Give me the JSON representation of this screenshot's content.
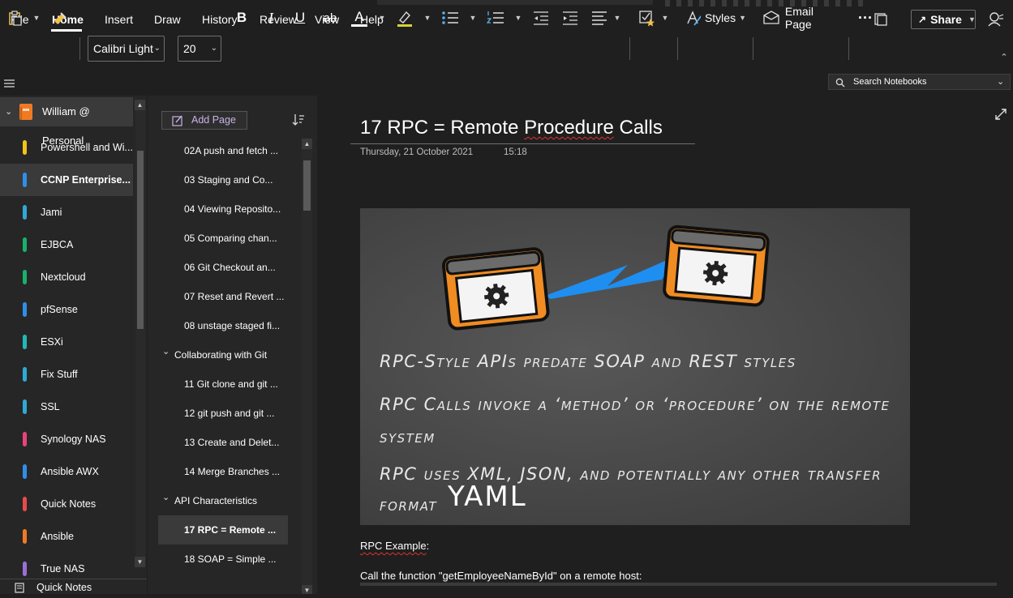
{
  "menu": {
    "items": [
      "File",
      "Home",
      "Insert",
      "Draw",
      "History",
      "Review",
      "View",
      "Help"
    ],
    "active": "Home"
  },
  "header_actions": {
    "share_label": "Share"
  },
  "ribbon": {
    "font_name": "Calibri Light",
    "font_size": "20",
    "bold": "B",
    "italic": "I",
    "underline": "U",
    "strike": "ab",
    "font_color": "A",
    "styles_label": "Styles",
    "email_label": "Email Page",
    "more_label": "···"
  },
  "search": {
    "placeholder": "Search Notebooks"
  },
  "notebook": {
    "name": "William @ Personal",
    "sections": [
      {
        "label": "Powershell and Wi...",
        "color": "#f2c318"
      },
      {
        "label": "CCNP Enterprise...",
        "color": "#2f8fe8"
      },
      {
        "label": "Jami",
        "color": "#2fa9d6"
      },
      {
        "label": "EJBCA",
        "color": "#18b06a"
      },
      {
        "label": "Nextcloud",
        "color": "#18b06a"
      },
      {
        "label": "pfSense",
        "color": "#2f8fe8"
      },
      {
        "label": "ESXi",
        "color": "#22b8b8"
      },
      {
        "label": "Fix Stuff",
        "color": "#2fa9d6"
      },
      {
        "label": "SSL",
        "color": "#2fa9d6"
      },
      {
        "label": "Synology NAS",
        "color": "#e8447a"
      },
      {
        "label": "Ansible AWX",
        "color": "#2f8fe8"
      },
      {
        "label": "Quick Notes",
        "color": "#e84b4b"
      },
      {
        "label": "Ansible",
        "color": "#f07a23"
      },
      {
        "label": "True NAS",
        "color": "#9b6fd8"
      }
    ],
    "selected_index": 1,
    "bottom_label": "Quick Notes"
  },
  "pages": {
    "add_label": "Add Page",
    "items": [
      {
        "label": "02A push and fetch ...",
        "level": 2
      },
      {
        "label": "03 Staging and Co...",
        "level": 2
      },
      {
        "label": "04 Viewing Reposito...",
        "level": 2
      },
      {
        "label": "05 Comparing chan...",
        "level": 2
      },
      {
        "label": "06 Git Checkout an...",
        "level": 2
      },
      {
        "label": "07 Reset and Revert ...",
        "level": 2
      },
      {
        "label": "08 unstage staged fi...",
        "level": 2
      },
      {
        "label": "Collaborating with Git",
        "level": 1
      },
      {
        "label": "11 Git clone and git ...",
        "level": 2
      },
      {
        "label": "12 git push and git ...",
        "level": 2
      },
      {
        "label": "13 Create and Delet...",
        "level": 2
      },
      {
        "label": "14 Merge Branches ...",
        "level": 2
      },
      {
        "label": "API Characteristics",
        "level": 1
      },
      {
        "label": "17 RPC = Remote ...",
        "level": 2
      },
      {
        "label": "18 SOAP = Simple ...",
        "level": 2
      }
    ],
    "selected_index": 13
  },
  "page": {
    "title_prefix": "17 RPC = Remote ",
    "title_wavy": "Procedure",
    "title_suffix": " Calls",
    "date": "Thursday, 21 October 2021",
    "time": "15:18",
    "image_lines": [
      "RPC-Style APIs predate SOAP and REST styles",
      "RPC Calls invoke a ‘method’ or ‘procedure’ on the remote",
      "system",
      "RPC uses XML, JSON, and potentially any other transfer",
      "format"
    ],
    "image_handwritten": "YAML",
    "body_line1_wavy": "RPC Example",
    "body_line1_suffix": ":",
    "body_line2_prefix": "Call the function \"",
    "body_line2_wavy": "getEmployeeNameById",
    "body_line2_suffix": "\" on a remote host:"
  },
  "colors": {
    "accent": "#c7b3e8",
    "background": "#1f1f1f",
    "panel": "#262626",
    "selected": "#3a3a3a",
    "gear_box": "#f08c22",
    "bolt": "#1e8ff0"
  }
}
